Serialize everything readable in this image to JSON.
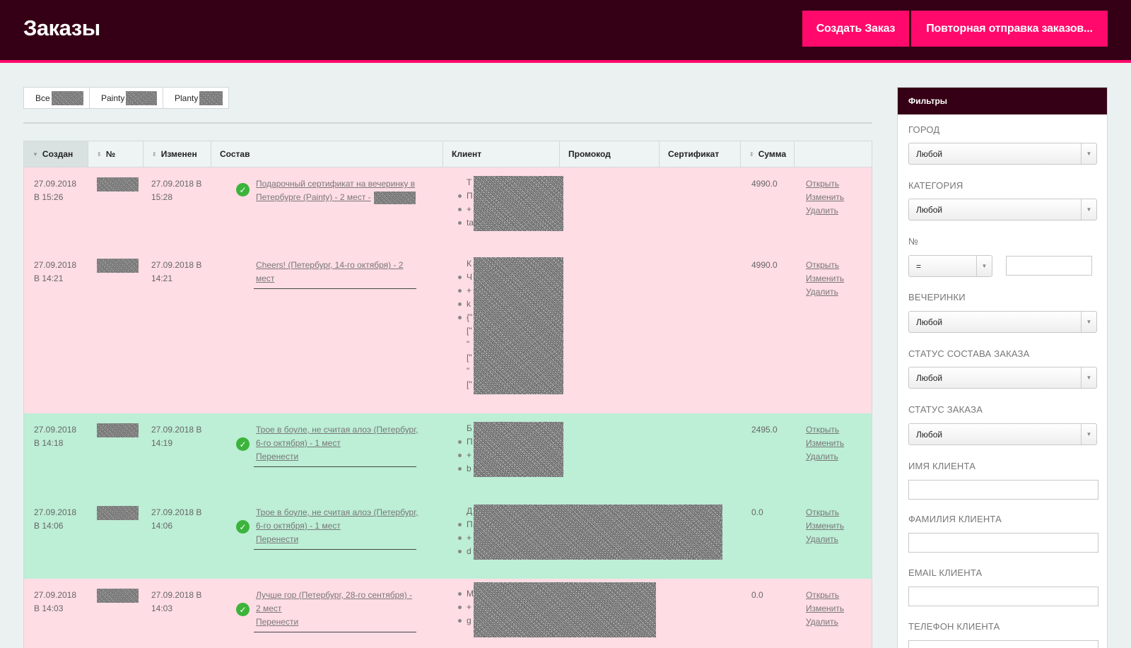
{
  "header": {
    "title": "Заказы",
    "create_button": "Создать Заказ",
    "resend_button": "Повторная отправка заказов..."
  },
  "tabs": [
    {
      "label": "Все"
    },
    {
      "label": "Painty"
    },
    {
      "label": "Planty"
    }
  ],
  "table": {
    "columns": [
      "Создан",
      "№",
      "Изменен",
      "Состав",
      "Клиент",
      "Промокод",
      "Сертификат",
      "Сумма",
      ""
    ],
    "actions": {
      "open": "Открыть",
      "edit": "Изменить",
      "delete": "Удалить"
    },
    "rows": [
      {
        "created_date": "27.09.2018",
        "created_time": "В 15:26",
        "modified_date": "27.09.2018 В",
        "modified_time": "15:28",
        "composition": "Подарочный сертификат на вечеринку в Петербурге (Painty) - 2 мест -",
        "sum": "4990.0",
        "color": "pink"
      },
      {
        "created_date": "27.09.2018",
        "created_time": "В 14:21",
        "modified_date": "27.09.2018 В",
        "modified_time": "14:21",
        "composition": "Cheers! (Петербург, 14-го октября) - 2 мест",
        "sum": "4990.0",
        "color": "pink"
      },
      {
        "created_date": "27.09.2018",
        "created_time": "В 14:18",
        "modified_date": "27.09.2018 В",
        "modified_time": "14:19",
        "composition": "Трое в боуле, не считая алоэ (Петербург, 6-го октября) - 1 мест",
        "move": "Перенести",
        "sum": "2495.0",
        "color": "green"
      },
      {
        "created_date": "27.09.2018",
        "created_time": "В 14:06",
        "modified_date": "27.09.2018 В",
        "modified_time": "14:06",
        "composition": "Трое в боуле, не считая алоэ (Петербург, 6-го октября) - 1 мест",
        "move": "Перенести",
        "sum": "0.0",
        "color": "green"
      },
      {
        "created_date": "27.09.2018",
        "created_time": "В 14:03",
        "modified_date": "27.09.2018 В",
        "modified_time": "14:03",
        "composition": "Лучше гор (Петербург, 28-го сентября) - 2 мест",
        "move": "Перенести",
        "sum": "0.0",
        "color": "pink"
      }
    ],
    "client_fragments": {
      "r0": [
        "Т",
        "П",
        "+",
        "ta"
      ],
      "r1": [
        "К",
        "Ч",
        "+",
        "k",
        "{\"",
        "[\"",
        "\"",
        "[\"",
        "\"",
        "[\""
      ],
      "r2": [
        "Б",
        "П",
        "+",
        "b"
      ],
      "r3": [
        "Д",
        "П",
        "+",
        "d"
      ],
      "r4": [
        "М",
        "+",
        "g"
      ]
    }
  },
  "filters": {
    "title": "Фильтры",
    "city_label": "ГОРОД",
    "city_value": "Любой",
    "category_label": "КАТЕГОРИЯ",
    "category_value": "Любой",
    "number_label": "№",
    "number_op": "=",
    "party_label": "ВЕЧЕРИНКИ",
    "party_value": "Любой",
    "comp_status_label": "СТАТУС СОСТАВА ЗАКАЗА",
    "comp_status_value": "Любой",
    "order_status_label": "СТАТУС ЗАКАЗА",
    "order_status_value": "Любой",
    "client_name_label": "ИМЯ КЛИЕНТА",
    "client_surname_label": "ФАМИЛИЯ КЛИЕНТА",
    "client_email_label": "EMAIL КЛИЕНТА",
    "client_phone_label": "ТЕЛЕФОН КЛИЕНТА"
  }
}
